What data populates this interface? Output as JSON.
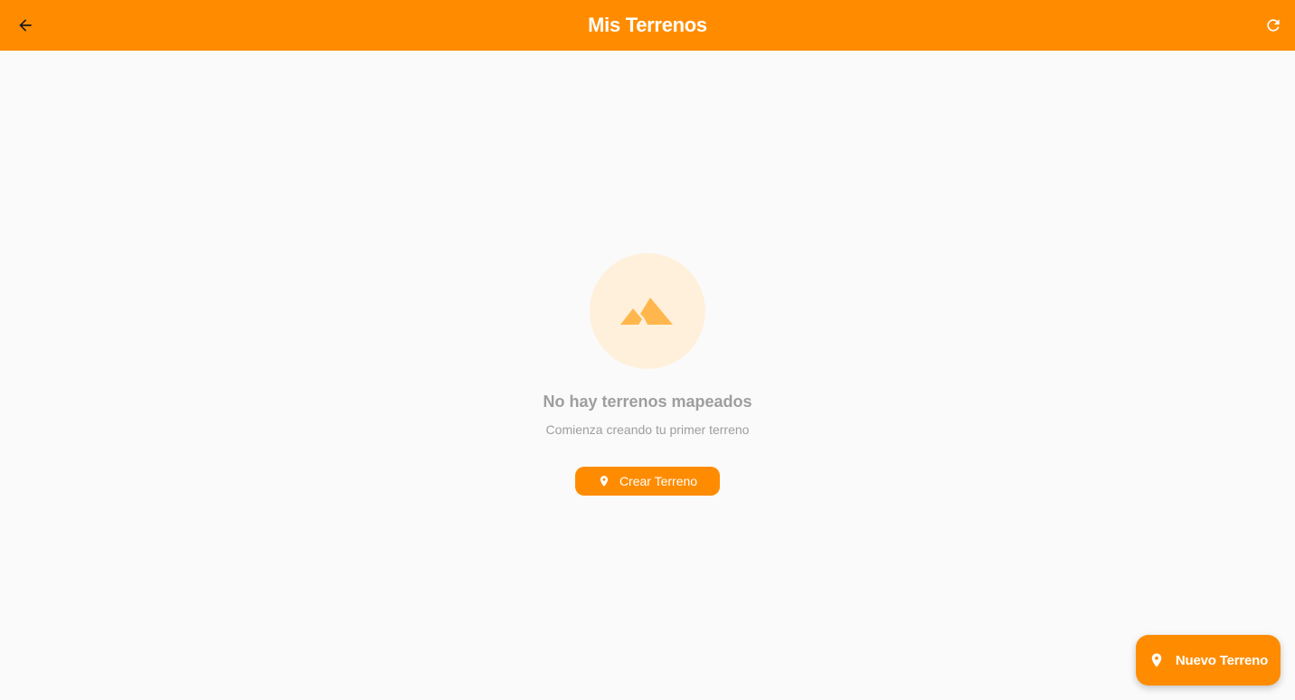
{
  "app_bar": {
    "title": "Mis Terrenos",
    "back_icon": "arrow-back-icon",
    "refresh_icon": "refresh-icon",
    "color": "#ff8c00"
  },
  "empty_state": {
    "illustration_icon": "landscape-icon",
    "title": "No hay terrenos mapeados",
    "subtitle": "Comienza creando tu primer terreno",
    "create_button": {
      "icon": "location-pin-icon",
      "label": "Crear Terreno"
    }
  },
  "fab": {
    "icon": "location-pin-icon",
    "label": "Nuevo Terreno"
  },
  "colors": {
    "accent": "#ff8c00",
    "background": "#fafafa",
    "muted_text": "#9e9e9e",
    "illustration_bg": "#fff0dc",
    "illustration_fg": "#ffb74d"
  }
}
